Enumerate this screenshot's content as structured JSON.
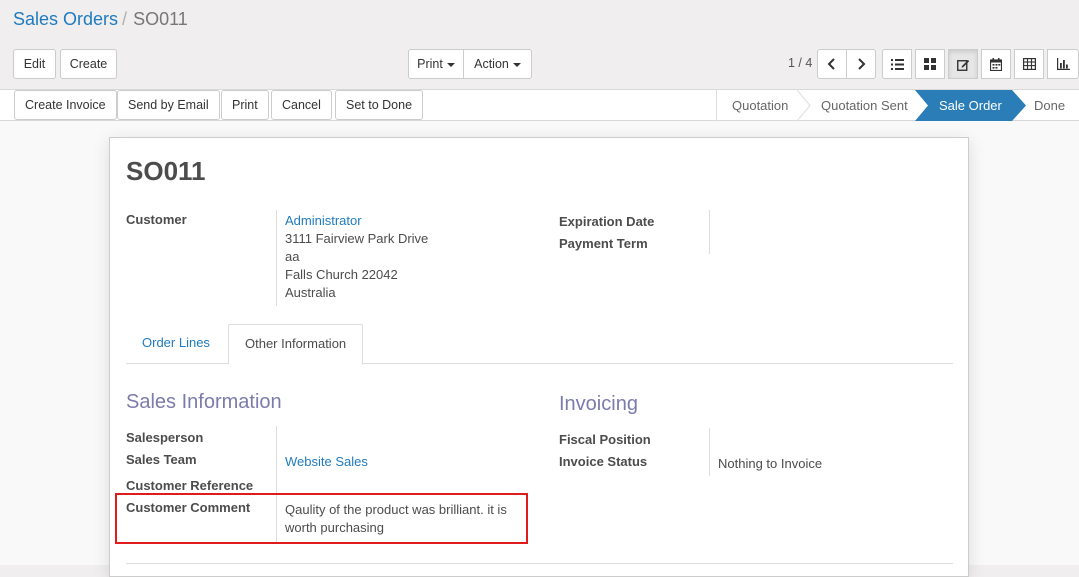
{
  "breadcrumb": {
    "parent": "Sales Orders",
    "separator": "/",
    "current": "SO011"
  },
  "toolbar": {
    "edit_label": "Edit",
    "create_label": "Create",
    "print_label": "Print",
    "action_label": "Action",
    "pager_value": "1 / 4",
    "views": [
      "list-view-icon",
      "kanban-view-icon",
      "form-view-icon",
      "calendar-view-icon",
      "pivot-view-icon",
      "graph-view-icon"
    ],
    "active_view": "form-view-icon"
  },
  "statusbar": {
    "buttons": [
      "Create Invoice",
      "Send by Email",
      "Print",
      "Cancel",
      "Set to Done"
    ],
    "stages": [
      "Quotation",
      "Quotation Sent",
      "Sale Order",
      "Done"
    ],
    "active_stage": "Sale Order",
    "active_color": "#2a7db6"
  },
  "form": {
    "title": "SO011",
    "customer_label": "Customer",
    "customer_name": "Administrator",
    "address_lines": [
      "3111 Fairview Park Drive",
      "aa",
      "Falls Church 22042",
      "Australia"
    ],
    "expiration_label": "Expiration Date",
    "payment_term_label": "Payment Term",
    "tabs": [
      "Order Lines",
      "Other Information"
    ],
    "active_tab": "Other Information",
    "sales_info": {
      "heading": "Sales Information",
      "salesperson_label": "Salesperson",
      "sales_team_label": "Sales Team",
      "sales_team_value": "Website Sales",
      "customer_reference_label": "Customer Reference",
      "customer_comment_label": "Customer Comment",
      "customer_comment_line1": "Qaulity of the product was brilliant. it is",
      "customer_comment_line2": "worth purchasing"
    },
    "invoicing": {
      "heading": "Invoicing",
      "fiscal_position_label": "Fiscal Position",
      "invoice_status_label": "Invoice Status",
      "invoice_status_value": "Nothing to Invoice"
    }
  },
  "colors": {
    "link": "#1f7bbf",
    "section_heading": "#7c7bad",
    "highlight_border": "#e01b1b"
  }
}
